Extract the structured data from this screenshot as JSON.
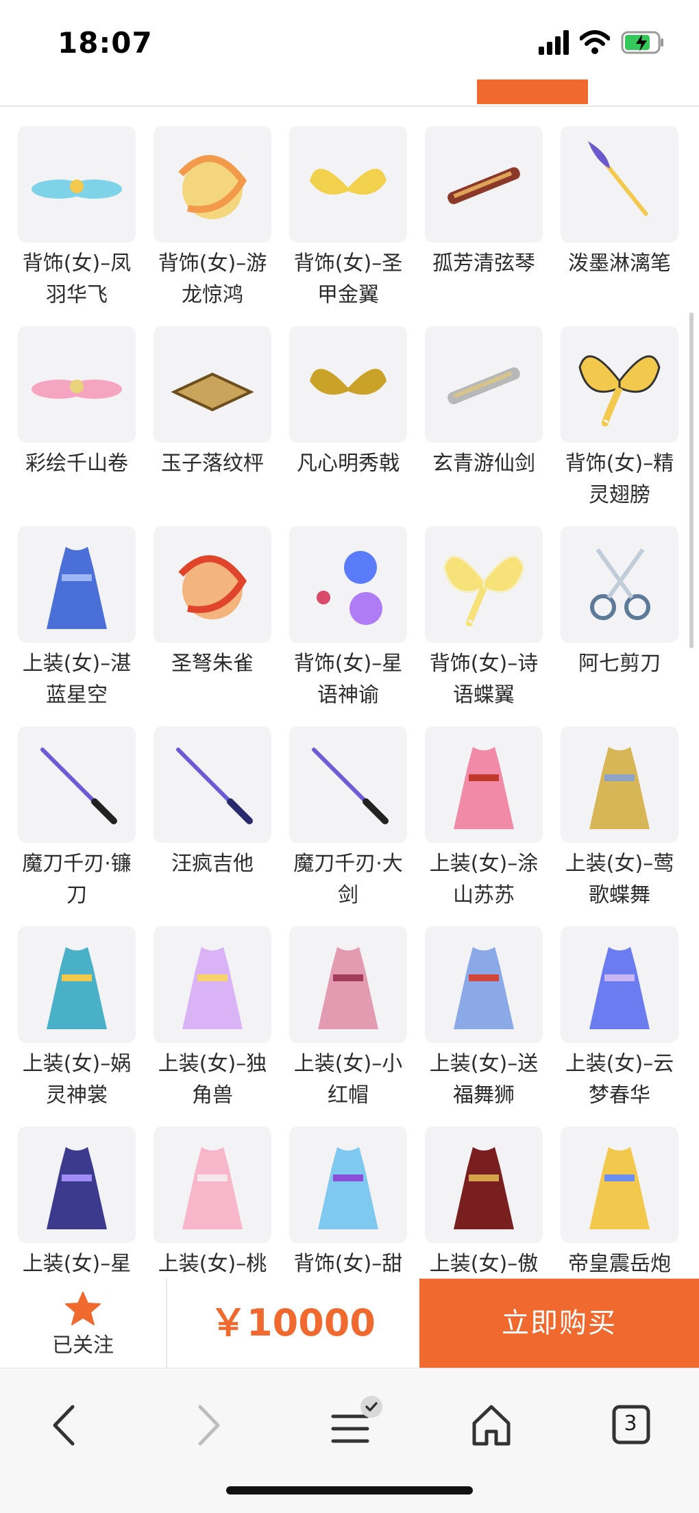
{
  "status": {
    "time": "18:07",
    "icons": [
      "cellular-signal-icon",
      "wifi-icon",
      "battery-charging-icon"
    ]
  },
  "colors": {
    "accent": "#f06a2f",
    "thumb_bg": "#f3f3f5"
  },
  "items": [
    {
      "name": "背饰(女)–凤羽华飞",
      "icon": "phoenix-wings-icon"
    },
    {
      "name": "背饰(女)–游龙惊鸿",
      "icon": "golden-dragon-icon"
    },
    {
      "name": "背饰(女)–圣甲金翼",
      "icon": "golden-wings-icon"
    },
    {
      "name": "孤芳清弦琴",
      "icon": "zither-icon"
    },
    {
      "name": "泼墨淋漓笔",
      "icon": "brush-icon"
    },
    {
      "name": "彩绘千山卷",
      "icon": "scroll-icon"
    },
    {
      "name": "玉子落纹枰",
      "icon": "go-board-icon"
    },
    {
      "name": "凡心明秀戟",
      "icon": "halberd-icon"
    },
    {
      "name": "玄青游仙剑",
      "icon": "twin-swords-icon"
    },
    {
      "name": "背饰(女)–精灵翅膀",
      "icon": "butterfly-wings-icon"
    },
    {
      "name": "上装(女)–湛蓝星空",
      "icon": "blue-dress-icon"
    },
    {
      "name": "圣弩朱雀",
      "icon": "red-bird-crossbow-icon"
    },
    {
      "name": "背饰(女)–星语神谕",
      "icon": "star-orbs-icon"
    },
    {
      "name": "背饰(女)–诗语蝶翼",
      "icon": "butterfly-wings-icon"
    },
    {
      "name": "阿七剪刀",
      "icon": "scissors-icon"
    },
    {
      "name": "魔刀千刃·镰刀",
      "icon": "katana-icon"
    },
    {
      "name": "汪疯吉他",
      "icon": "guitar-icon"
    },
    {
      "name": "魔刀千刃·大剑",
      "icon": "katana-icon"
    },
    {
      "name": "上装(女)–涂山苏苏",
      "icon": "pink-robe-icon"
    },
    {
      "name": "上装(女)–莺歌蝶舞",
      "icon": "gold-costume-icon"
    },
    {
      "name": "上装(女)–娲灵神裳",
      "icon": "teal-costume-icon"
    },
    {
      "name": "上装(女)–独角兽",
      "icon": "unicorn-outfit-icon"
    },
    {
      "name": "上装(女)–小红帽",
      "icon": "pink-dress-icon"
    },
    {
      "name": "上装(女)–送福舞狮",
      "icon": "lion-dance-outfit-icon"
    },
    {
      "name": "上装(女)–云梦春华",
      "icon": "blue-robe-icon"
    },
    {
      "name": "上装(女)–星",
      "icon": "navy-costume-icon"
    },
    {
      "name": "上装(女)–桃",
      "icon": "peach-kimono-icon"
    },
    {
      "name": "背饰(女)–甜",
      "icon": "blue-dragon-pet-icon"
    },
    {
      "name": "上装(女)–傲",
      "icon": "dark-red-costume-icon"
    },
    {
      "name": "帝皇震岳炮",
      "icon": "cannon-icon"
    }
  ],
  "buy_bar": {
    "follow_label": "已关注",
    "follow_icon": "star-icon",
    "price": "￥10000",
    "buy_label": "立即购买"
  },
  "browser": {
    "tabs_count": "3",
    "buttons": [
      "back-icon",
      "forward-icon",
      "menu-icon",
      "home-icon",
      "tabs-icon"
    ]
  }
}
